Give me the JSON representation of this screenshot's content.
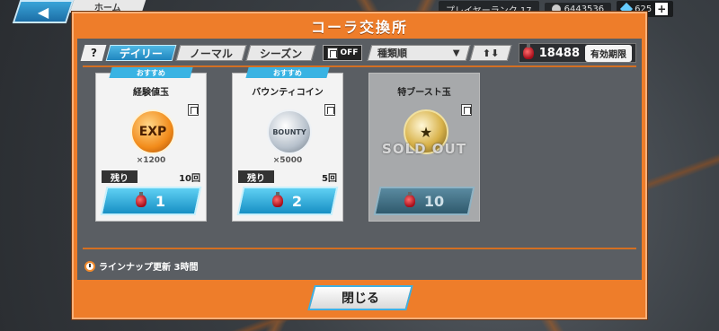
{
  "top_bar": {
    "home_label": "ホーム",
    "rank_text": "プレイヤーランク 17",
    "coins": "6443536",
    "gems": "625",
    "plus_label": "+"
  },
  "dialog": {
    "title": "コーラ交換所",
    "help_label": "?",
    "tabs": [
      {
        "label": "デイリー",
        "active": true
      },
      {
        "label": "ノーマル",
        "active": false
      },
      {
        "label": "シーズン",
        "active": false
      }
    ],
    "bookmark_filter": "OFF",
    "sort_label": "種類順",
    "sort_order_label": "⬆⬇",
    "currency_amount": "18488",
    "expiry_label": "有効期限",
    "items": [
      {
        "badge": "おすすめ",
        "name": "経験値玉",
        "art_text": "EXP",
        "quantity": "×1200",
        "remain_label": "残り",
        "remain": "10回",
        "price": "1",
        "sold_out": false
      },
      {
        "badge": "おすすめ",
        "name": "バウンティコイン",
        "art_text": "BOUNTY",
        "quantity": "×5000",
        "remain_label": "残り",
        "remain": "5回",
        "price": "2",
        "sold_out": false
      },
      {
        "badge": "",
        "name": "特ブースト玉",
        "art_text": "★",
        "quantity": "",
        "sold_out_text": "SOLD OUT",
        "price": "10",
        "sold_out": true
      }
    ],
    "lineup_text": "ラインナップ更新 3時間",
    "close_label": "閉じる"
  },
  "colors": {
    "dialog_orange": "#ee7d2a",
    "tab_active": "#1f86bf",
    "panel_gray": "#5a5e63"
  }
}
